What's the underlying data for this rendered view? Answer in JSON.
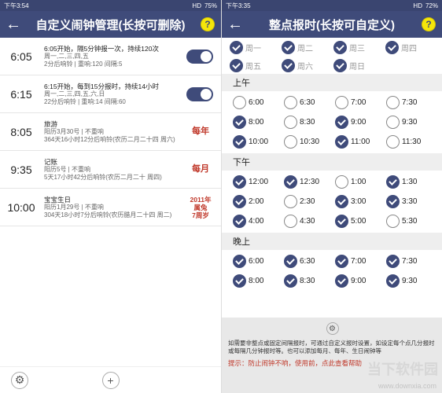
{
  "left": {
    "status": {
      "time": "下午3:54",
      "network": "HD",
      "battery": "75%"
    },
    "title": "自定义闹钟管理(长按可删除)",
    "help": "?",
    "alarms": [
      {
        "time": "6:05",
        "line1": "6:05开始，隔5分钟报一次，持续120次",
        "line2": "周一,二,三,四,五",
        "line3": "2分后响铃 | 重响:120  间隔:5",
        "enabled": true
      },
      {
        "time": "6:15",
        "line1": "6:15开始，每到15分报时，持续14小时",
        "line2": "周一,二,三,四,五,六,日",
        "line3": "22分后响铃 | 重响:14  间隔:60",
        "enabled": true
      },
      {
        "time": "8:05",
        "line1": "旅游",
        "line2": "阳历3月30号 | 不重响",
        "line3": "364天16小时12分后响铃(农历二月二十四 周六)",
        "tag": "每年"
      },
      {
        "time": "9:35",
        "line1": "记账",
        "line2": "阳历5号 | 不重响",
        "line3": "5天17小时42分后响铃(农历二月二十 周四)",
        "tag": "每月"
      },
      {
        "time": "10:00",
        "line1": "宝宝生日",
        "line2": "阳历1月29号 | 不重响",
        "line3": "304天18小时7分后响铃(农历腊月二十四 周二)",
        "tag": "2011年 属兔 7周岁"
      }
    ],
    "add_label": "+"
  },
  "right": {
    "status": {
      "time": "下午3:35",
      "network": "HD",
      "battery": "72%"
    },
    "title": "整点报时(长按可自定义)",
    "help": "?",
    "weekdays": [
      {
        "label": "周一",
        "checked": true,
        "dim": true
      },
      {
        "label": "周二",
        "checked": true,
        "dim": true
      },
      {
        "label": "周三",
        "checked": true,
        "dim": true
      },
      {
        "label": "周四",
        "checked": true,
        "dim": true
      },
      {
        "label": "周五",
        "checked": true,
        "dim": true
      },
      {
        "label": "周六",
        "checked": true,
        "dim": true
      },
      {
        "label": "周日",
        "checked": true,
        "dim": true
      }
    ],
    "sections": [
      {
        "title": "上午",
        "slots": [
          {
            "t": "6:00",
            "on": false
          },
          {
            "t": "6:30",
            "on": false
          },
          {
            "t": "7:00",
            "on": false
          },
          {
            "t": "7:30",
            "on": false
          },
          {
            "t": "8:00",
            "on": true
          },
          {
            "t": "8:30",
            "on": false
          },
          {
            "t": "9:00",
            "on": true
          },
          {
            "t": "9:30",
            "on": false
          },
          {
            "t": "10:00",
            "on": true
          },
          {
            "t": "10:30",
            "on": false
          },
          {
            "t": "11:00",
            "on": true
          },
          {
            "t": "11:30",
            "on": false
          }
        ]
      },
      {
        "title": "下午",
        "slots": [
          {
            "t": "12:00",
            "on": true
          },
          {
            "t": "12:30",
            "on": true
          },
          {
            "t": "1:00",
            "on": false
          },
          {
            "t": "1:30",
            "on": true
          },
          {
            "t": "2:00",
            "on": true
          },
          {
            "t": "2:30",
            "on": false
          },
          {
            "t": "3:00",
            "on": true
          },
          {
            "t": "3:30",
            "on": true
          },
          {
            "t": "4:00",
            "on": true
          },
          {
            "t": "4:30",
            "on": false
          },
          {
            "t": "5:00",
            "on": true
          },
          {
            "t": "5:30",
            "on": false
          }
        ]
      },
      {
        "title": "晚上",
        "slots": [
          {
            "t": "6:00",
            "on": true
          },
          {
            "t": "6:30",
            "on": true
          },
          {
            "t": "7:00",
            "on": true
          },
          {
            "t": "7:30",
            "on": true
          },
          {
            "t": "8:00",
            "on": true
          },
          {
            "t": "8:30",
            "on": true
          },
          {
            "t": "9:00",
            "on": true
          },
          {
            "t": "9:30",
            "on": true
          }
        ]
      }
    ],
    "note": "如需要非整点或固定间隔报时，可通过自定义报时设置，如设定每个点几分报时或每隔几分钟报时等。也可以添加每月、每年、生日闹钟等",
    "tip": "提示：防止闹钟不响，使用前，点此查看帮助",
    "watermark": "当下软件园",
    "watermark_url": "www.downxia.com"
  },
  "colors": {
    "header": "#3f4b7a",
    "accent": "#c0392b",
    "help": "#f5e60a"
  }
}
